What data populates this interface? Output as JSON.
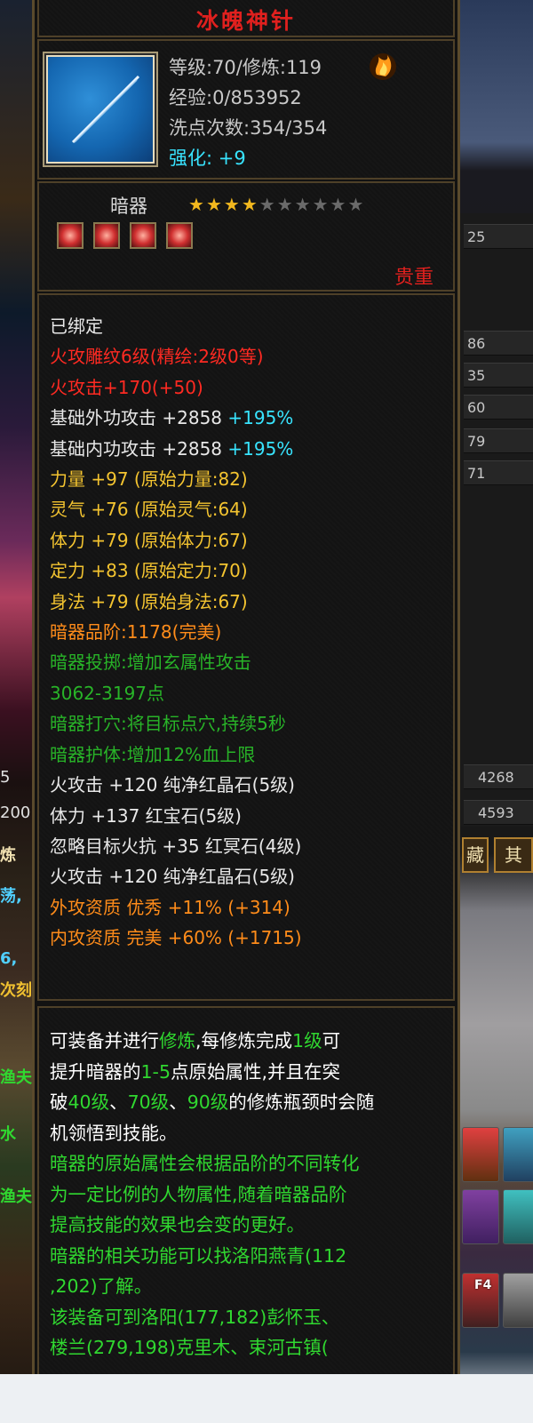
{
  "item": {
    "name": "冰魄神针",
    "level_line": "等级:70/修炼:119",
    "exp_line": "经验:0/853952",
    "wash_line": "洗点次数:354/354",
    "enhance_label": "强化:",
    "enhance_value": "+9",
    "type": "暗器",
    "stars_filled": 4,
    "stars_total": 10,
    "rarity": "贵重",
    "icon": "needle-weapon-icon"
  },
  "attributes": [
    {
      "text": "已绑定",
      "color": "wt"
    },
    {
      "text": "火攻雕纹6级(精绘:2级0等)",
      "color": "r"
    },
    {
      "text": "火攻击+170(+50)",
      "color": "r"
    },
    {
      "text": "基础外功攻击 +2858",
      "extra": "+195%",
      "color": "wt",
      "extra_color": "c"
    },
    {
      "text": "基础内功攻击 +2858",
      "extra": "+195%",
      "color": "wt",
      "extra_color": "c"
    },
    {
      "text": "力量 +97 (原始力量:82)",
      "color": "y"
    },
    {
      "text": "灵气 +76 (原始灵气:64)",
      "color": "y"
    },
    {
      "text": "体力 +79 (原始体力:67)",
      "color": "y"
    },
    {
      "text": "定力 +83 (原始定力:70)",
      "color": "y"
    },
    {
      "text": "身法 +79 (原始身法:67)",
      "color": "y"
    },
    {
      "text": "暗器品阶:1178(完美)",
      "color": "o"
    },
    {
      "text": "暗器投掷:增加玄属性攻击",
      "color": "dg"
    },
    {
      "text": "3062-3197点",
      "color": "dg"
    },
    {
      "text": "暗器打穴:将目标点穴,持续5秒",
      "color": "dg"
    },
    {
      "text": "暗器护体:增加12%血上限",
      "color": "dg"
    },
    {
      "text": "火攻击 +120 纯净红晶石(5级)",
      "color": "wt"
    },
    {
      "text": "体力 +137 红宝石(5级)",
      "color": "wt"
    },
    {
      "text": "忽略目标火抗 +35 红冥石(4级)",
      "color": "wt"
    },
    {
      "text": "火攻击 +120 纯净红晶石(5级)",
      "color": "wt"
    },
    {
      "text": "外攻资质 优秀 +11% (+314)",
      "color": "o"
    },
    {
      "text": "内攻资质 完美 +60% (+1715)",
      "color": "o"
    }
  ],
  "description": [
    [
      {
        "t": "可装备并进行",
        "c": "w"
      },
      {
        "t": "修炼",
        "c": "g"
      },
      {
        "t": ",每修炼完成",
        "c": "w"
      },
      {
        "t": "1级",
        "c": "g"
      },
      {
        "t": "可",
        "c": "w"
      }
    ],
    [
      {
        "t": "提升暗器的",
        "c": "w"
      },
      {
        "t": "1-5",
        "c": "g"
      },
      {
        "t": "点原始属性,并且在突",
        "c": "w"
      }
    ],
    [
      {
        "t": "破",
        "c": "w"
      },
      {
        "t": "40级",
        "c": "g"
      },
      {
        "t": "、",
        "c": "w"
      },
      {
        "t": "70级",
        "c": "g"
      },
      {
        "t": "、",
        "c": "w"
      },
      {
        "t": "90级",
        "c": "g"
      },
      {
        "t": "的修炼瓶颈时会随",
        "c": "w"
      }
    ],
    [
      {
        "t": "机领悟到技能。",
        "c": "w"
      }
    ],
    [
      {
        "t": "暗器的原始属性会根据品阶的不同转化",
        "c": "g"
      }
    ],
    [
      {
        "t": "为一定比例的人物属性,随着暗器品阶",
        "c": "g"
      }
    ],
    [
      {
        "t": "提高技能的效果也会变的更好。",
        "c": "g"
      }
    ],
    [
      {
        "t": "暗器的相关功能可以找洛阳燕青(112",
        "c": "g"
      }
    ],
    [
      {
        "t": ",202)了解。",
        "c": "g"
      }
    ],
    [
      {
        "t": "该装备可到洛阳(177,182)彭怀玉、",
        "c": "g"
      }
    ],
    [
      {
        "t": "楼兰(279,198)克里木、束河古镇(",
        "c": "g"
      }
    ]
  ],
  "background": {
    "right_numbers": [
      "25",
      "86",
      "35",
      "60",
      "79",
      "71"
    ],
    "right_bottom_numbers": [
      "4268",
      "4593"
    ],
    "left_numbers": [
      "5",
      "200"
    ],
    "right_tabs": [
      "藏",
      "其"
    ],
    "left_tab": "炼",
    "left_texts": [
      "荡,",
      "6,",
      "次刻",
      "渔夫",
      "水",
      "渔夫"
    ],
    "hotkey": "F4"
  }
}
